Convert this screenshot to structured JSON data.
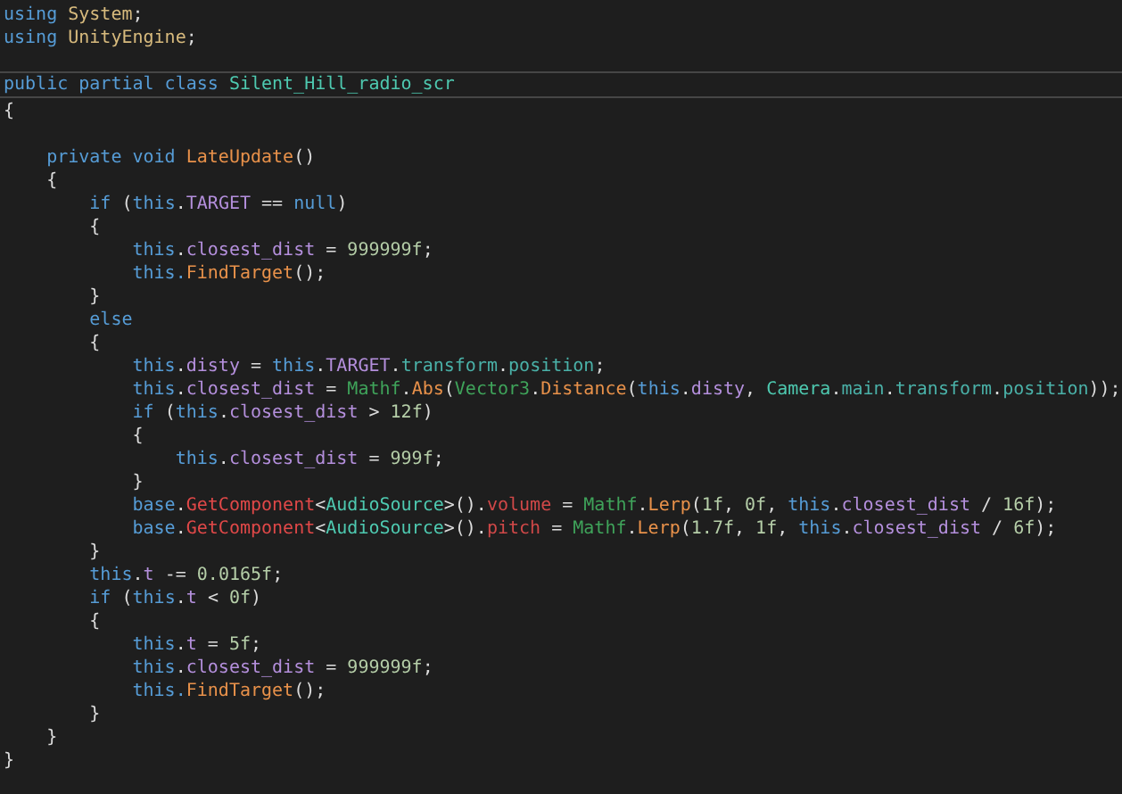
{
  "editor": {
    "blocks": [
      {
        "lines": [
          {
            "highlighted": false,
            "tokens": [
              {
                "kind": "kw",
                "text": "using "
              },
              {
                "kind": "ns",
                "text": "System"
              },
              {
                "kind": "plain",
                "text": ";"
              }
            ]
          },
          {
            "highlighted": false,
            "tokens": [
              {
                "kind": "kw",
                "text": "using "
              },
              {
                "kind": "ns",
                "text": "UnityEngine"
              },
              {
                "kind": "plain",
                "text": ";"
              }
            ]
          }
        ]
      },
      {
        "lines": [
          {
            "highlighted": true,
            "tokens": [
              {
                "kind": "kw",
                "text": "public partial class "
              },
              {
                "kind": "cls",
                "text": "Silent_Hill_radio_scr"
              }
            ]
          },
          {
            "highlighted": false,
            "tokens": [
              {
                "kind": "plain",
                "text": "{"
              }
            ]
          }
        ]
      },
      {
        "lines": [
          {
            "highlighted": false,
            "tokens": [
              {
                "kind": "kw",
                "text": "    private void "
              },
              {
                "kind": "method",
                "text": "LateUpdate"
              },
              {
                "kind": "plain",
                "text": "()"
              }
            ]
          },
          {
            "highlighted": false,
            "tokens": [
              {
                "kind": "plain",
                "text": "    {"
              }
            ]
          },
          {
            "highlighted": false,
            "tokens": [
              {
                "kind": "kw",
                "text": "        if"
              },
              {
                "kind": "plain",
                "text": " ("
              },
              {
                "kind": "kw",
                "text": "this"
              },
              {
                "kind": "plain",
                "text": "."
              },
              {
                "kind": "field",
                "text": "TARGET"
              },
              {
                "kind": "plain",
                "text": " == "
              },
              {
                "kind": "kw",
                "text": "null"
              },
              {
                "kind": "plain",
                "text": ")"
              }
            ]
          },
          {
            "highlighted": false,
            "tokens": [
              {
                "kind": "plain",
                "text": "        {"
              }
            ]
          },
          {
            "highlighted": false,
            "tokens": [
              {
                "kind": "kw",
                "text": "            this"
              },
              {
                "kind": "plain",
                "text": "."
              },
              {
                "kind": "field",
                "text": "closest_dist"
              },
              {
                "kind": "plain",
                "text": " = "
              },
              {
                "kind": "num",
                "text": "999999f"
              },
              {
                "kind": "plain",
                "text": ";"
              }
            ]
          },
          {
            "highlighted": false,
            "tokens": [
              {
                "kind": "kw",
                "text": "            this."
              },
              {
                "kind": "method",
                "text": "FindTarget"
              },
              {
                "kind": "plain",
                "text": "();"
              }
            ]
          },
          {
            "highlighted": false,
            "tokens": [
              {
                "kind": "plain",
                "text": "        }"
              }
            ]
          },
          {
            "highlighted": false,
            "tokens": [
              {
                "kind": "kw",
                "text": "        else"
              }
            ]
          },
          {
            "highlighted": false,
            "tokens": [
              {
                "kind": "plain",
                "text": "        {"
              }
            ]
          },
          {
            "highlighted": false,
            "tokens": [
              {
                "kind": "kw",
                "text": "            this"
              },
              {
                "kind": "plain",
                "text": "."
              },
              {
                "kind": "field",
                "text": "disty"
              },
              {
                "kind": "plain",
                "text": " = "
              },
              {
                "kind": "kw",
                "text": "this"
              },
              {
                "kind": "plain",
                "text": "."
              },
              {
                "kind": "field",
                "text": "TARGET"
              },
              {
                "kind": "plain",
                "text": "."
              },
              {
                "kind": "prop",
                "text": "transform"
              },
              {
                "kind": "plain",
                "text": "."
              },
              {
                "kind": "prop",
                "text": "position"
              },
              {
                "kind": "plain",
                "text": ";"
              }
            ]
          },
          {
            "highlighted": false,
            "tokens": [
              {
                "kind": "kw",
                "text": "            this"
              },
              {
                "kind": "plain",
                "text": "."
              },
              {
                "kind": "field",
                "text": "closest_dist"
              },
              {
                "kind": "plain",
                "text": " = "
              },
              {
                "kind": "static",
                "text": "Mathf"
              },
              {
                "kind": "plain",
                "text": "."
              },
              {
                "kind": "method",
                "text": "Abs"
              },
              {
                "kind": "plain",
                "text": "("
              },
              {
                "kind": "static",
                "text": "Vector3"
              },
              {
                "kind": "plain",
                "text": "."
              },
              {
                "kind": "method",
                "text": "Distance"
              },
              {
                "kind": "plain",
                "text": "("
              },
              {
                "kind": "kw",
                "text": "this"
              },
              {
                "kind": "plain",
                "text": "."
              },
              {
                "kind": "field",
                "text": "disty"
              },
              {
                "kind": "plain",
                "text": ", "
              },
              {
                "kind": "cls",
                "text": "Camera"
              },
              {
                "kind": "plain",
                "text": "."
              },
              {
                "kind": "prop",
                "text": "main"
              },
              {
                "kind": "plain",
                "text": "."
              },
              {
                "kind": "prop",
                "text": "transform"
              },
              {
                "kind": "plain",
                "text": "."
              },
              {
                "kind": "prop",
                "text": "position"
              },
              {
                "kind": "plain",
                "text": "));"
              }
            ]
          },
          {
            "highlighted": false,
            "tokens": [
              {
                "kind": "kw",
                "text": "            if"
              },
              {
                "kind": "plain",
                "text": " ("
              },
              {
                "kind": "kw",
                "text": "this"
              },
              {
                "kind": "plain",
                "text": "."
              },
              {
                "kind": "field",
                "text": "closest_dist"
              },
              {
                "kind": "plain",
                "text": " > "
              },
              {
                "kind": "num",
                "text": "12f"
              },
              {
                "kind": "plain",
                "text": ")"
              }
            ]
          },
          {
            "highlighted": false,
            "tokens": [
              {
                "kind": "plain",
                "text": "            {"
              }
            ]
          },
          {
            "highlighted": false,
            "tokens": [
              {
                "kind": "kw",
                "text": "                this"
              },
              {
                "kind": "plain",
                "text": "."
              },
              {
                "kind": "field",
                "text": "closest_dist"
              },
              {
                "kind": "plain",
                "text": " = "
              },
              {
                "kind": "num",
                "text": "999f"
              },
              {
                "kind": "plain",
                "text": ";"
              }
            ]
          },
          {
            "highlighted": false,
            "tokens": [
              {
                "kind": "plain",
                "text": "            }"
              }
            ]
          },
          {
            "highlighted": false,
            "tokens": [
              {
                "kind": "kw",
                "text": "            base"
              },
              {
                "kind": "plain",
                "text": "."
              },
              {
                "kind": "generic",
                "text": "GetComponent"
              },
              {
                "kind": "plain",
                "text": "<"
              },
              {
                "kind": "cls",
                "text": "AudioSource"
              },
              {
                "kind": "plain",
                "text": ">()."
              },
              {
                "kind": "accent",
                "text": "volume"
              },
              {
                "kind": "plain",
                "text": " = "
              },
              {
                "kind": "static",
                "text": "Mathf"
              },
              {
                "kind": "plain",
                "text": "."
              },
              {
                "kind": "method",
                "text": "Lerp"
              },
              {
                "kind": "plain",
                "text": "("
              },
              {
                "kind": "num",
                "text": "1f"
              },
              {
                "kind": "plain",
                "text": ", "
              },
              {
                "kind": "num",
                "text": "0f"
              },
              {
                "kind": "plain",
                "text": ", "
              },
              {
                "kind": "kw",
                "text": "this"
              },
              {
                "kind": "plain",
                "text": "."
              },
              {
                "kind": "field",
                "text": "closest_dist"
              },
              {
                "kind": "plain",
                "text": " / "
              },
              {
                "kind": "num",
                "text": "16f"
              },
              {
                "kind": "plain",
                "text": ");"
              }
            ]
          },
          {
            "highlighted": false,
            "tokens": [
              {
                "kind": "kw",
                "text": "            base"
              },
              {
                "kind": "plain",
                "text": "."
              },
              {
                "kind": "generic",
                "text": "GetComponent"
              },
              {
                "kind": "plain",
                "text": "<"
              },
              {
                "kind": "cls",
                "text": "AudioSource"
              },
              {
                "kind": "plain",
                "text": ">()."
              },
              {
                "kind": "accent",
                "text": "pitch"
              },
              {
                "kind": "plain",
                "text": " = "
              },
              {
                "kind": "static",
                "text": "Mathf"
              },
              {
                "kind": "plain",
                "text": "."
              },
              {
                "kind": "method",
                "text": "Lerp"
              },
              {
                "kind": "plain",
                "text": "("
              },
              {
                "kind": "num",
                "text": "1.7f"
              },
              {
                "kind": "plain",
                "text": ", "
              },
              {
                "kind": "num",
                "text": "1f"
              },
              {
                "kind": "plain",
                "text": ", "
              },
              {
                "kind": "kw",
                "text": "this"
              },
              {
                "kind": "plain",
                "text": "."
              },
              {
                "kind": "field",
                "text": "closest_dist"
              },
              {
                "kind": "plain",
                "text": " / "
              },
              {
                "kind": "num",
                "text": "6f"
              },
              {
                "kind": "plain",
                "text": ");"
              }
            ]
          },
          {
            "highlighted": false,
            "tokens": [
              {
                "kind": "plain",
                "text": "        }"
              }
            ]
          },
          {
            "highlighted": false,
            "tokens": [
              {
                "kind": "kw",
                "text": "        this"
              },
              {
                "kind": "plain",
                "text": "."
              },
              {
                "kind": "field",
                "text": "t"
              },
              {
                "kind": "plain",
                "text": " -= "
              },
              {
                "kind": "num",
                "text": "0.0165f"
              },
              {
                "kind": "plain",
                "text": ";"
              }
            ]
          },
          {
            "highlighted": false,
            "tokens": [
              {
                "kind": "kw",
                "text": "        if"
              },
              {
                "kind": "plain",
                "text": " ("
              },
              {
                "kind": "kw",
                "text": "this"
              },
              {
                "kind": "plain",
                "text": "."
              },
              {
                "kind": "field",
                "text": "t"
              },
              {
                "kind": "plain",
                "text": " < "
              },
              {
                "kind": "num",
                "text": "0f"
              },
              {
                "kind": "plain",
                "text": ")"
              }
            ]
          },
          {
            "highlighted": false,
            "tokens": [
              {
                "kind": "plain",
                "text": "        {"
              }
            ]
          },
          {
            "highlighted": false,
            "tokens": [
              {
                "kind": "kw",
                "text": "            this"
              },
              {
                "kind": "plain",
                "text": "."
              },
              {
                "kind": "field",
                "text": "t"
              },
              {
                "kind": "plain",
                "text": " = "
              },
              {
                "kind": "num",
                "text": "5f"
              },
              {
                "kind": "plain",
                "text": ";"
              }
            ]
          },
          {
            "highlighted": false,
            "tokens": [
              {
                "kind": "kw",
                "text": "            this"
              },
              {
                "kind": "plain",
                "text": "."
              },
              {
                "kind": "field",
                "text": "closest_dist"
              },
              {
                "kind": "plain",
                "text": " = "
              },
              {
                "kind": "num",
                "text": "999999f"
              },
              {
                "kind": "plain",
                "text": ";"
              }
            ]
          },
          {
            "highlighted": false,
            "tokens": [
              {
                "kind": "kw",
                "text": "            this."
              },
              {
                "kind": "method",
                "text": "FindTarget"
              },
              {
                "kind": "plain",
                "text": "();"
              }
            ]
          },
          {
            "highlighted": false,
            "tokens": [
              {
                "kind": "plain",
                "text": "        }"
              }
            ]
          },
          {
            "highlighted": false,
            "tokens": [
              {
                "kind": "plain",
                "text": "    }"
              }
            ]
          },
          {
            "highlighted": false,
            "tokens": [
              {
                "kind": "plain",
                "text": "}"
              }
            ]
          }
        ]
      }
    ]
  }
}
